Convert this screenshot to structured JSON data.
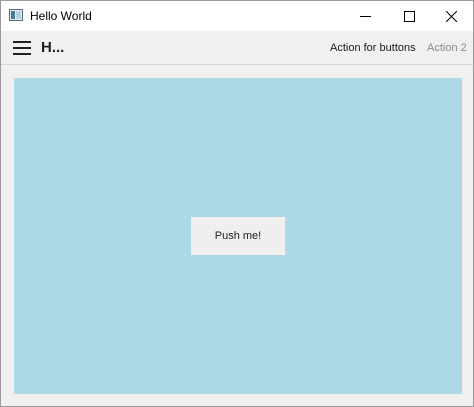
{
  "window": {
    "title": "Hello World",
    "icon": "app-window-icon"
  },
  "toolbar": {
    "menu_icon": "hamburger-menu-icon",
    "title": "H...",
    "actions": [
      {
        "label": "Action for buttons",
        "enabled": true
      },
      {
        "label": "Action 2",
        "enabled": false
      }
    ]
  },
  "content": {
    "background_color": "#add8e6",
    "button_label": "Push me!"
  },
  "window_controls": {
    "minimize_icon": "minimize-icon",
    "maximize_icon": "maximize-icon",
    "close_icon": "close-icon"
  }
}
